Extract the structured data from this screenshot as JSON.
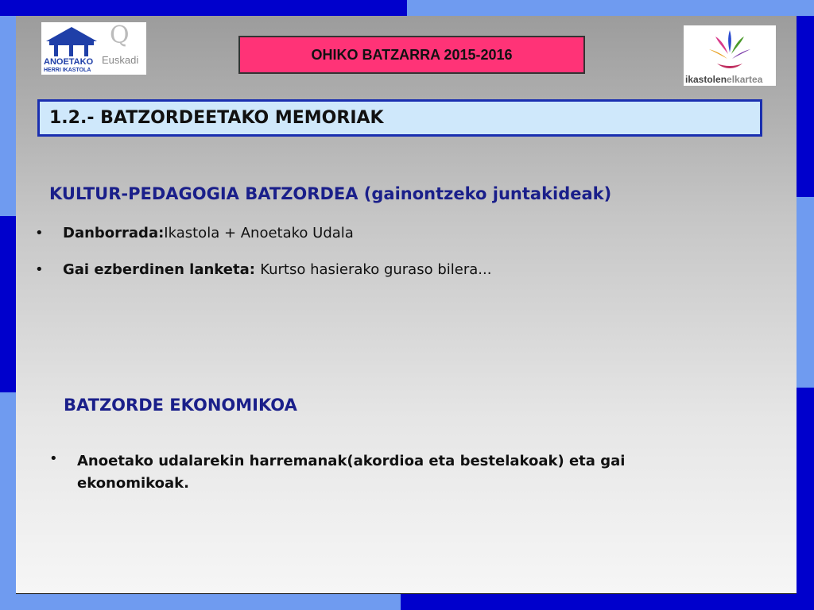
{
  "header": {
    "meeting_title": "OHIKO BATZARRA 2015-2016",
    "logo_left": {
      "name": "ANOETAKO",
      "sub": "HERRI IKASTOLA",
      "badge": "Euskadi"
    },
    "logo_right": {
      "name_part1": "ikastolen",
      "name_part2": "elkartea"
    }
  },
  "section_title": "1.2.- BATZORDEETAKO MEMORIAK",
  "kultur": {
    "heading": "KULTUR-PEDAGOGIA BATZORDEA (gainontzeko juntakideak)",
    "items": [
      {
        "bullet": "•",
        "label": "Danborrada:",
        "text": "Ikastola + Anoetako Udala"
      },
      {
        "bullet": "•",
        "label": "Gai ezberdinen lanketa: ",
        "text": "Kurtso hasierako guraso  bilera..."
      }
    ]
  },
  "ekonomiko": {
    "heading": "BATZORDE EKONOMIKOA",
    "items": [
      {
        "bullet": "•",
        "text": "Anoetako udalarekin harremanak(akordioa eta bestelakoak) eta gai ekonomikoak."
      }
    ]
  },
  "colors": {
    "frame_dark": "#0000cc",
    "frame_light": "#6f9bf0",
    "heading": "#1a1f8a",
    "meeting_bg": "#ff3377",
    "section_bg": "#cfe8fb"
  }
}
